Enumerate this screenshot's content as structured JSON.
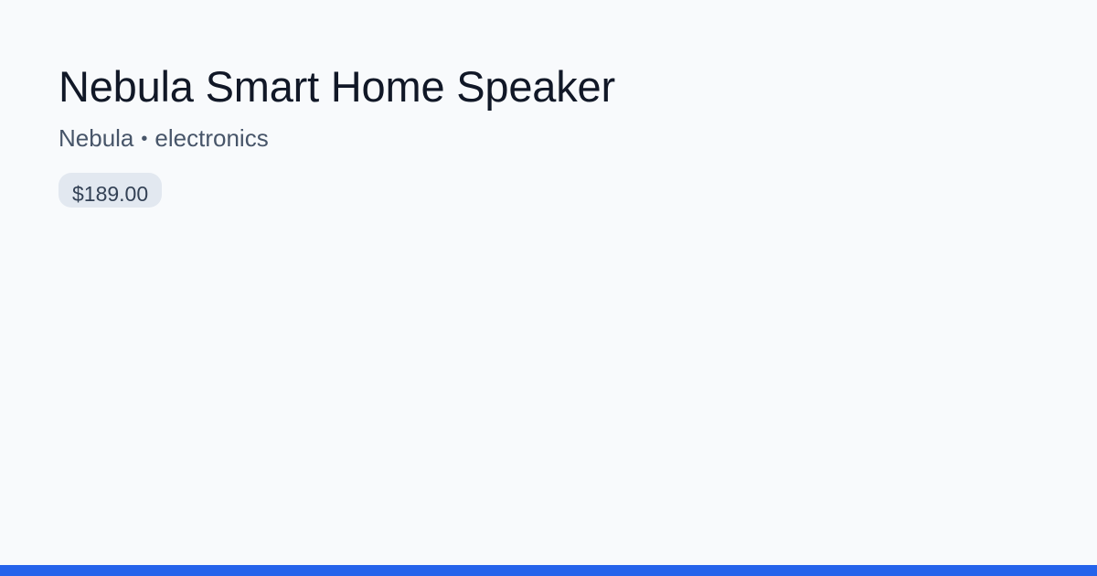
{
  "product": {
    "title": "Nebula Smart Home Speaker",
    "brand": "Nebula",
    "separator": "•",
    "category": "electronics",
    "price": "$189.00"
  },
  "colors": {
    "background": "#f8fafc",
    "title": "#111827",
    "meta": "#475569",
    "price_badge_bg": "#e2e8f0",
    "price_text": "#334155",
    "accent_bar": "#2563eb"
  }
}
